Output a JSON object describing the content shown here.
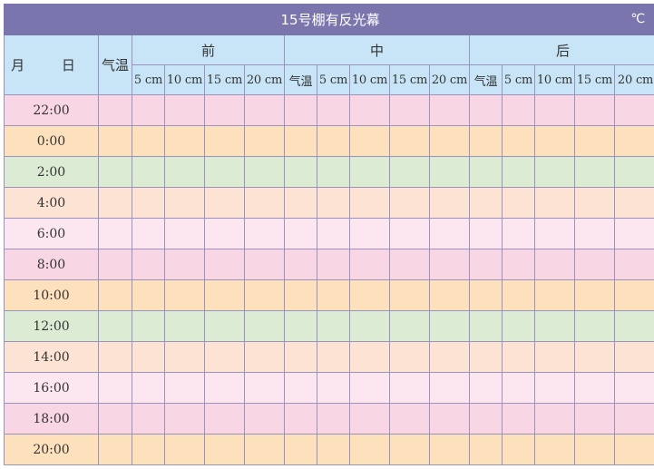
{
  "table": {
    "title": "15号棚有反光幕",
    "unit": "℃",
    "date_header": "月 日",
    "air_temp": "气温",
    "sections": [
      "前",
      "中",
      "后"
    ],
    "depths": [
      "5 cm",
      "10 cm",
      "15 cm",
      "20 cm"
    ],
    "rows": [
      {
        "time": "22:00",
        "color": "#f8d6e4"
      },
      {
        "time": "0:00",
        "color": "#fde0bc"
      },
      {
        "time": "2:00",
        "color": "#dcecd4"
      },
      {
        "time": "4:00",
        "color": "#fde3d3"
      },
      {
        "time": "6:00",
        "color": "#fce7f1"
      },
      {
        "time": "8:00",
        "color": "#f8d6e4"
      },
      {
        "time": "10:00",
        "color": "#fde0bc"
      },
      {
        "time": "12:00",
        "color": "#dcecd4"
      },
      {
        "time": "14:00",
        "color": "#fde3d3"
      },
      {
        "time": "16:00",
        "color": "#fce7f1"
      },
      {
        "time": "18:00",
        "color": "#f8d6e4"
      },
      {
        "time": "20:00",
        "color": "#fde0bc"
      }
    ]
  },
  "colors": {
    "title_bar": "#7a76ad",
    "header": "#c7e5f6",
    "border": "#9a93bd"
  }
}
